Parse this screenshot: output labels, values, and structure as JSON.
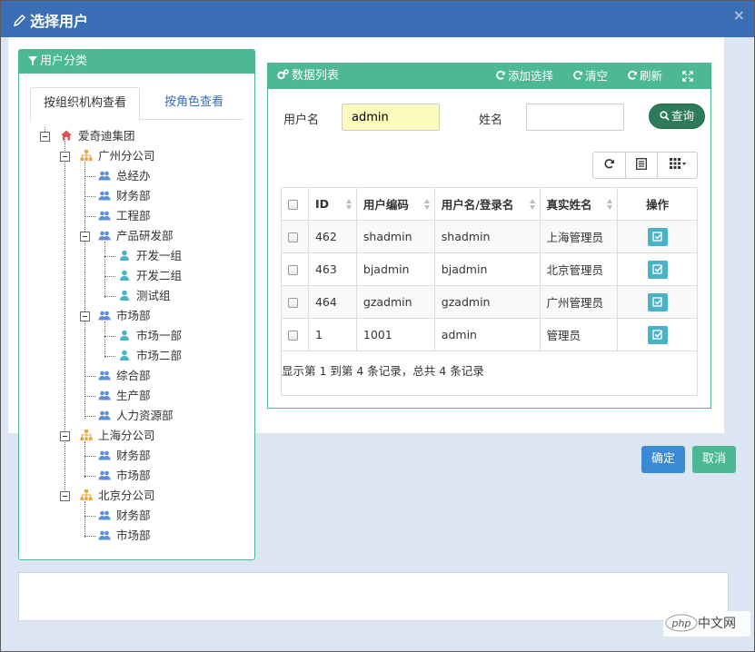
{
  "dialog": {
    "title": "选择用户",
    "close": "×"
  },
  "left_panel": {
    "title": "用户分类",
    "tabs": [
      {
        "label": "按组织机构查看",
        "active": true
      },
      {
        "label": "按角色查看",
        "active": false
      }
    ],
    "tree": {
      "root": "爱奇迪集团",
      "gz": "广州分公司",
      "gz_1": "总经办",
      "gz_2": "财务部",
      "gz_3": "工程部",
      "gz_4": "产品研发部",
      "gz_4_1": "开发一组",
      "gz_4_2": "开发二组",
      "gz_4_3": "测试组",
      "gz_5": "市场部",
      "gz_5_1": "市场一部",
      "gz_5_2": "市场二部",
      "gz_6": "综合部",
      "gz_7": "生产部",
      "gz_8": "人力资源部",
      "sh": "上海分公司",
      "sh_1": "财务部",
      "sh_2": "市场部",
      "bj": "北京分公司",
      "bj_1": "财务部",
      "bj_2": "市场部"
    }
  },
  "right_panel": {
    "title": "数据列表",
    "tools": {
      "add": "添加选择",
      "clear": "清空",
      "refresh": "刷新"
    },
    "search": {
      "username_label": "用户名",
      "username_value": "admin",
      "realname_label": "姓名",
      "realname_value": "",
      "query_button": "查询"
    },
    "table": {
      "headers": {
        "id": "ID",
        "code": "用户编码",
        "login": "用户名/登录名",
        "name": "真实姓名",
        "op": "操作"
      },
      "rows": [
        {
          "id": "462",
          "code": "shadmin",
          "login": "shadmin",
          "name": "上海管理员"
        },
        {
          "id": "463",
          "code": "bjadmin",
          "login": "bjadmin",
          "name": "北京管理员"
        },
        {
          "id": "464",
          "code": "gzadmin",
          "login": "gzadmin",
          "name": "广州管理员"
        },
        {
          "id": "1",
          "code": "1001",
          "login": "admin",
          "name": "管理员"
        }
      ],
      "summary": "显示第 1 到第 4 条记录，总共 4 条记录"
    }
  },
  "footer": {
    "ok": "确定",
    "cancel": "取消"
  },
  "watermark": {
    "text": "中文网"
  },
  "colors": {
    "header": "#3a6eb5",
    "green": "#4cb993",
    "dark_green": "#2e7b5c",
    "ok_blue": "#3a8ad6",
    "op_cyan": "#49b2c6"
  }
}
